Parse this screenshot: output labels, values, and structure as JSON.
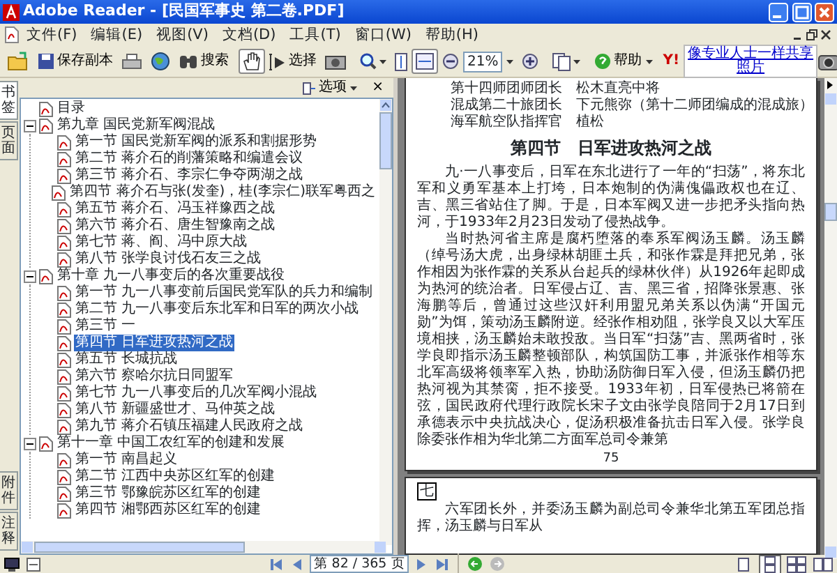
{
  "window": {
    "title": "Adobe Reader - [民国军事史 第二卷.PDF]"
  },
  "menu": [
    "文件(F)",
    "编辑(E)",
    "视图(V)",
    "文档(D)",
    "工具(T)",
    "窗口(W)",
    "帮助(H)"
  ],
  "toolbar": {
    "save_copy": "保存副本",
    "search": "搜索",
    "hand_tool": {
      "selected": true
    },
    "select": "选择",
    "fit_width": {
      "selected": true
    },
    "zoom": "21%",
    "help": "帮助",
    "yahoo": "Y!",
    "ad": [
      "像专业人士一样共享",
      "照片"
    ]
  },
  "sidebar": {
    "tabs_top": [
      {
        "label": "书签",
        "selected": true
      },
      {
        "label": "页面",
        "selected": false
      }
    ],
    "tabs_bottom": [
      {
        "label": "附件",
        "selected": false
      },
      {
        "label": "注释",
        "selected": false
      }
    ],
    "options": "选项",
    "close": "×",
    "bookmarks": [
      {
        "label": "目录",
        "selected": false
      },
      {
        "label": "第九章 国民党新军阀混战",
        "selected": false,
        "expanded": true,
        "children": [
          {
            "label": "第一节 国民党新军阀的派系和割据形势",
            "selected": false
          },
          {
            "label": "第二节 蒋介石的削藩策略和编遣会议",
            "selected": false
          },
          {
            "label": "第三节 蒋介石、李宗仁争夺两湖之战",
            "selected": false
          },
          {
            "label": "第四节 蒋介石与张(发奎)，桂(李宗仁)联军粤西之",
            "selected": false
          },
          {
            "label": "第五节 蒋介石、冯玉祥豫西之战",
            "selected": false
          },
          {
            "label": "第六节 蒋介石、唐生智豫南之战",
            "selected": false
          },
          {
            "label": "第七节 蒋、阎、冯中原大战",
            "selected": false
          },
          {
            "label": "第八节 张学良讨伐石友三之战",
            "selected": false
          }
        ]
      },
      {
        "label": "第十章 九一八事变后的各次重要战役",
        "selected": false,
        "expanded": true,
        "children": [
          {
            "label": "第一节 九一八事变前后国民党军队的兵力和编制",
            "selected": false
          },
          {
            "label": "第二节 九一八事变后东北军和日军的两次小战",
            "selected": false
          },
          {
            "label": "第三节 一",
            "selected": false
          },
          {
            "label": "第四节 日军进攻热河之战",
            "selected": true
          },
          {
            "label": "第五节 长城抗战",
            "selected": false
          },
          {
            "label": "第六节 察哈尔抗日同盟军",
            "selected": false
          },
          {
            "label": "第七节 九一八事变后的几次军阀小混战",
            "selected": false
          },
          {
            "label": "第八节 新疆盛世才、马仲英之战",
            "selected": false
          },
          {
            "label": "第九节 蒋介石镇压福建人民政府之战",
            "selected": false
          }
        ]
      },
      {
        "label": "第十一章 中国工农红军的创建和发展",
        "selected": false,
        "expanded": true,
        "children": [
          {
            "label": "第一节 南昌起义",
            "selected": false
          },
          {
            "label": "第二节 江西中央苏区红军的创建",
            "selected": false
          },
          {
            "label": "第三节 鄂豫皖苏区红军的创建",
            "selected": false
          },
          {
            "label": "第四节 湘鄂西苏区红军的创建",
            "selected": false
          }
        ]
      }
    ]
  },
  "document": {
    "pages": [
      {
        "header_lines": [
          "第十四师团师团长　松木直亮中将",
          "混成第二十旅团长　下元熊弥（第十二师团编成的混成旅）",
          "海军航空队指挥官　植松"
        ],
        "heading": "第四节　日军进攻热河之战",
        "paragraphs": [
          "九·一八事变后，日军在东北进行了一年的“扫荡”，将东北军和义勇军基本上打垮，日本炮制的伪满傀儡政权也在辽、吉、黑三省站住了脚。于是，日本军阀又进一步把矛头指向热河，于1933年2月23日发动了侵热战争。",
          "当时热河省主席是腐朽堕落的奉系军阀汤玉麟。汤玉麟（绰号汤大虎，出身绿林胡匪土兵，和张作霖是拜把兄弟，张作相因为张作霖的关系从台起兵的绿林伙伴）从1926年起即成为热河的统治者。日军侵占辽、吉、黑三省，招降张景惠、张海鹏等后，曾通过这些汉奸利用盟兄弟关系以伪满“开国元勋”为饵，策动汤玉麟附逆。经张作相劝阻，张学良又以大军压境相挟，汤玉麟始未敢投敌。当日军“扫荡”吉、黑两省时，张学良即指示汤玉麟整顿部队，构筑国防工事，并派张作相等东北军高级将领率军入热，协助汤防御日军入侵，但汤玉麟仍把热河视为其禁脔，拒不接受。1933年初，日军侵热已将箭在弦，国民政府代理行政院长宋子文由张学良陪同于2月17日到承德表示中央抗战决心，促汤积极准备抗击日军入侵。张学良除委张作相为华北第二方面军总司令兼第"
        ],
        "page_number": "75"
      },
      {
        "marker": "七",
        "paragraphs": [
          "六军团长外，并委汤玉麟为副总司令兼华北第五军团总指挥，汤玉麟与日军从"
        ]
      }
    ]
  },
  "status_bar": {
    "page": "第 82 / 365 页",
    "page_layouts": [
      {
        "kind": "single",
        "selected": false
      },
      {
        "kind": "continuous",
        "selected": true
      },
      {
        "kind": "facing-continuous",
        "selected": false
      },
      {
        "kind": "facing",
        "selected": false
      }
    ]
  }
}
